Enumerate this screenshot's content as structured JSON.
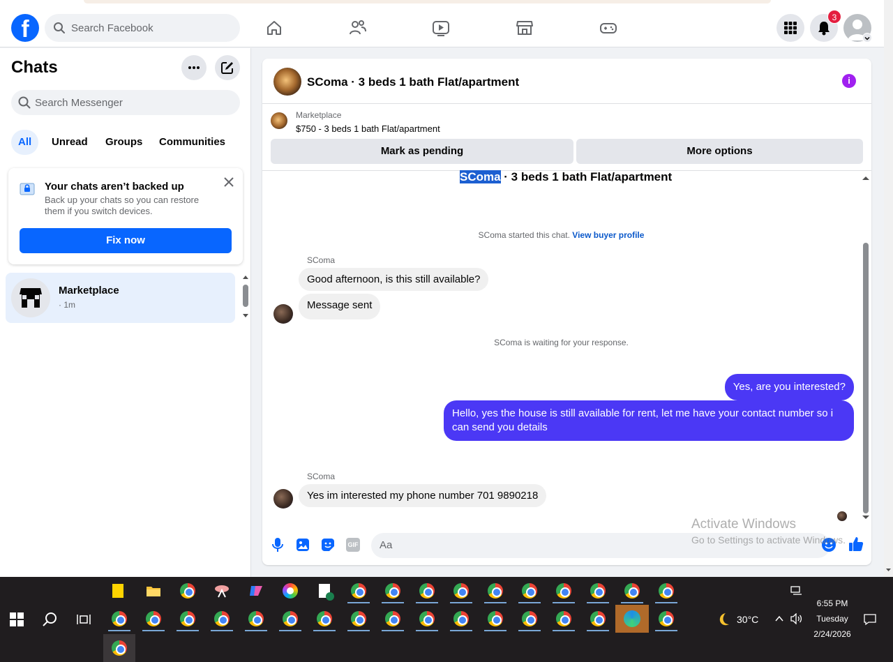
{
  "topbar": {
    "search_placeholder": "Search Facebook",
    "notification_count": "3",
    "logo_letter": "f"
  },
  "left": {
    "title": "Chats",
    "search_placeholder": "Search Messenger",
    "filters": [
      "All",
      "Unread",
      "Groups",
      "Communities"
    ],
    "backup": {
      "title": "Your chats aren’t backed up",
      "body": "Back up your chats so you can restore them if you switch devices.",
      "button": "Fix now"
    },
    "conversation": {
      "name": "Marketplace",
      "time": "· 1m"
    }
  },
  "chat": {
    "header_title": "SComa · 3 beds 1 bath Flat/apartment",
    "listing": {
      "label": "Marketplace",
      "title": "$750 - 3 beds 1 bath Flat/apartment",
      "pending_button": "Mark as pending",
      "more_button": "More options"
    },
    "thread_title_name": "SComa",
    "thread_title_rest": " · 3 beds 1 bath Flat/apartment",
    "started_text": "SComa started this chat.",
    "view_profile": "View buyer profile",
    "sender_name_1": "SComa",
    "msg_1": "Good afternoon, is this still available?",
    "msg_2": "Message sent",
    "waiting_text": "SComa is waiting for your response.",
    "out_1": "Yes, are you interested?",
    "out_2": "Hello, yes the house is still available for rent, let me have your contact number so i can send you details",
    "sender_name_2": "SComa",
    "msg_3": "Yes  im interested my phone number 701 9890218",
    "composer_placeholder": "Aa"
  },
  "watermark": {
    "line1": "Activate Windows",
    "line2": "Go to Settings to activate Windows."
  },
  "taskbar": {
    "temperature": "30°C",
    "time": "6:55 PM",
    "day": "Tuesday",
    "date": "2/24/2026"
  },
  "colors": {
    "facebook_blue": "#0866ff",
    "outgoing_bubble": "#4b38f5",
    "info_purple": "#a020f0",
    "badge_red": "#e41e3f"
  }
}
